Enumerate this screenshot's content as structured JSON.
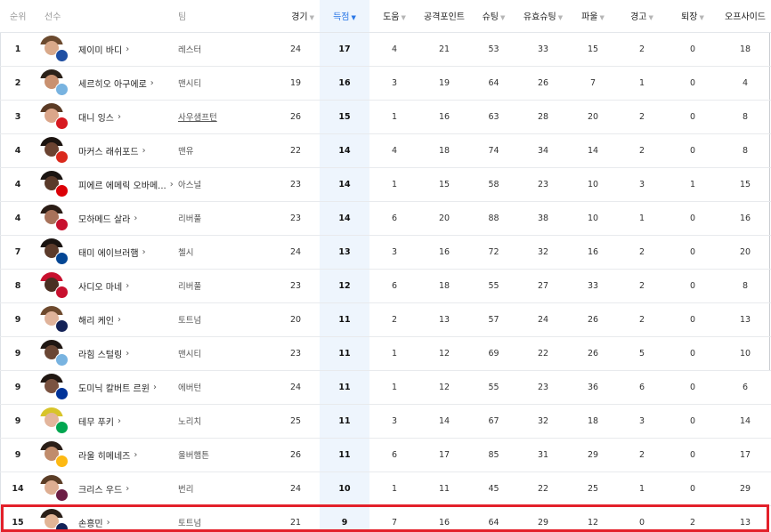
{
  "header": {
    "rank": "순위",
    "player": "선수",
    "team": "팀",
    "games": "경기",
    "goals": "득점",
    "assists": "도움",
    "attack_points": "공격포인트",
    "shots": "슈팅",
    "shots_on_target": "유효슈팅",
    "fouls": "파울",
    "yellow": "경고",
    "red": "퇴장",
    "offside": "오프사이드",
    "sort_desc_arrow": "▼",
    "sortable_arrow": "▼"
  },
  "rows": [
    {
      "rank": "1",
      "name": "제이미 바디",
      "team": "레스터",
      "games": "24",
      "goals": "17",
      "assists": "4",
      "ap": "21",
      "shots": "53",
      "sot": "33",
      "fouls": "15",
      "yellow": "2",
      "red": "0",
      "offside": "18",
      "chev": "›",
      "skin": "#d9a98a",
      "hair": "#6b4a2f",
      "badge": "#1f4fa3"
    },
    {
      "rank": "2",
      "name": "세르히오 아구에로",
      "team": "맨시티",
      "games": "19",
      "goals": "16",
      "assists": "3",
      "ap": "19",
      "shots": "64",
      "sot": "26",
      "fouls": "7",
      "yellow": "1",
      "red": "0",
      "offside": "4",
      "chev": "›",
      "skin": "#c99170",
      "hair": "#2b2118",
      "badge": "#78b3e0"
    },
    {
      "rank": "3",
      "name": "대니 잉스",
      "team": "사우샘프턴",
      "games": "26",
      "goals": "15",
      "assists": "1",
      "ap": "16",
      "shots": "63",
      "sot": "28",
      "fouls": "20",
      "yellow": "2",
      "red": "0",
      "offside": "8",
      "chev": "›",
      "skin": "#dba68a",
      "hair": "#5a3a24",
      "badge": "#d71920"
    },
    {
      "rank": "4",
      "name": "마커스 래쉬포드",
      "team": "맨유",
      "games": "22",
      "goals": "14",
      "assists": "4",
      "ap": "18",
      "shots": "74",
      "sot": "34",
      "fouls": "14",
      "yellow": "2",
      "red": "0",
      "offside": "8",
      "chev": "›",
      "skin": "#6b4331",
      "hair": "#1c1410",
      "badge": "#da291c"
    },
    {
      "rank": "4",
      "name": "피에르 에메릭 오바메...",
      "team": "아스널",
      "games": "23",
      "goals": "14",
      "assists": "1",
      "ap": "15",
      "shots": "58",
      "sot": "23",
      "fouls": "10",
      "yellow": "3",
      "red": "1",
      "offside": "15",
      "chev": "›",
      "skin": "#5a3a2a",
      "hair": "#1a1411",
      "badge": "#db0007"
    },
    {
      "rank": "4",
      "name": "모하메드 살라",
      "team": "리버풀",
      "games": "23",
      "goals": "14",
      "assists": "6",
      "ap": "20",
      "shots": "88",
      "sot": "38",
      "fouls": "10",
      "yellow": "1",
      "red": "0",
      "offside": "16",
      "chev": "›",
      "skin": "#a8725a",
      "hair": "#2a1c15",
      "badge": "#c8102e"
    },
    {
      "rank": "7",
      "name": "태미 에이브러햄",
      "team": "첼시",
      "games": "24",
      "goals": "13",
      "assists": "3",
      "ap": "16",
      "shots": "72",
      "sot": "32",
      "fouls": "16",
      "yellow": "2",
      "red": "0",
      "offside": "20",
      "chev": "›",
      "skin": "#5c3b2b",
      "hair": "#1a1310",
      "badge": "#034694"
    },
    {
      "rank": "8",
      "name": "사디오 마네",
      "team": "리버풀",
      "games": "23",
      "goals": "12",
      "assists": "6",
      "ap": "18",
      "shots": "55",
      "sot": "27",
      "fouls": "33",
      "yellow": "2",
      "red": "0",
      "offside": "8",
      "chev": "›",
      "skin": "#4a2f22",
      "hair": "#c8102e",
      "badge": "#c8102e"
    },
    {
      "rank": "9",
      "name": "해리 케인",
      "team": "토트넘",
      "games": "20",
      "goals": "11",
      "assists": "2",
      "ap": "13",
      "shots": "57",
      "sot": "24",
      "fouls": "26",
      "yellow": "2",
      "red": "0",
      "offside": "13",
      "chev": "›",
      "skin": "#e0b39a",
      "hair": "#6e4a2e",
      "badge": "#132257"
    },
    {
      "rank": "9",
      "name": "라힘 스털링",
      "team": "맨시티",
      "games": "23",
      "goals": "11",
      "assists": "1",
      "ap": "12",
      "shots": "69",
      "sot": "22",
      "fouls": "26",
      "yellow": "5",
      "red": "0",
      "offside": "10",
      "chev": "›",
      "skin": "#6a4634",
      "hair": "#1f1612",
      "badge": "#78b3e0"
    },
    {
      "rank": "9",
      "name": "도미닉 칼버트 르윈",
      "team": "에버턴",
      "games": "24",
      "goals": "11",
      "assists": "1",
      "ap": "12",
      "shots": "55",
      "sot": "23",
      "fouls": "36",
      "yellow": "6",
      "red": "0",
      "offside": "6",
      "chev": "›",
      "skin": "#7a5240",
      "hair": "#201712",
      "badge": "#003399"
    },
    {
      "rank": "9",
      "name": "테무 푸키",
      "team": "노리치",
      "games": "25",
      "goals": "11",
      "assists": "3",
      "ap": "14",
      "shots": "67",
      "sot": "32",
      "fouls": "18",
      "yellow": "3",
      "red": "0",
      "offside": "14",
      "chev": "›",
      "skin": "#e3b59c",
      "hair": "#d8c42a",
      "badge": "#00a650"
    },
    {
      "rank": "9",
      "name": "라울 히메네즈",
      "team": "울버햄튼",
      "games": "26",
      "goals": "11",
      "assists": "6",
      "ap": "17",
      "shots": "85",
      "sot": "31",
      "fouls": "29",
      "yellow": "2",
      "red": "0",
      "offside": "17",
      "chev": "›",
      "skin": "#c08c6c",
      "hair": "#2a1e17",
      "badge": "#fdb913"
    },
    {
      "rank": "14",
      "name": "크리스 우드",
      "team": "번리",
      "games": "24",
      "goals": "10",
      "assists": "1",
      "ap": "11",
      "shots": "45",
      "sot": "22",
      "fouls": "25",
      "yellow": "1",
      "red": "0",
      "offside": "29",
      "chev": "›",
      "skin": "#deae92",
      "hair": "#5b3d26",
      "badge": "#6c1d45"
    },
    {
      "rank": "15",
      "name": "손흥민",
      "team": "토트넘",
      "games": "21",
      "goals": "9",
      "assists": "7",
      "ap": "16",
      "shots": "64",
      "sot": "29",
      "fouls": "12",
      "yellow": "0",
      "red": "2",
      "offside": "13",
      "chev": "›",
      "skin": "#e2b596",
      "hair": "#2a1f18",
      "badge": "#132257"
    }
  ]
}
